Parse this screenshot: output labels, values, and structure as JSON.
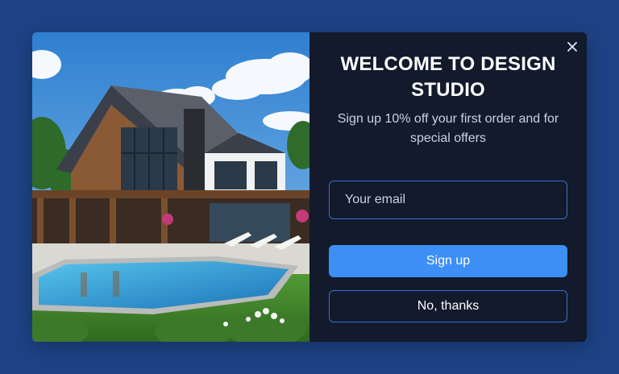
{
  "modal": {
    "title": "WELCOME TO DESIGN\nSTUDIO",
    "subtitle": "Sign up 10% off your first order and for special offers",
    "close_icon": "close-icon",
    "image_description_icon": "house-photo"
  },
  "form": {
    "email_placeholder": "Your email",
    "email_value": "",
    "signup_label": "Sign up",
    "decline_label": "No, thanks"
  },
  "colors": {
    "page_background": "#1e4285",
    "modal_background": "#121a2c",
    "accent": "#3d8ef5",
    "outline": "#3a6fd8",
    "muted_text": "#c9d1e3"
  }
}
